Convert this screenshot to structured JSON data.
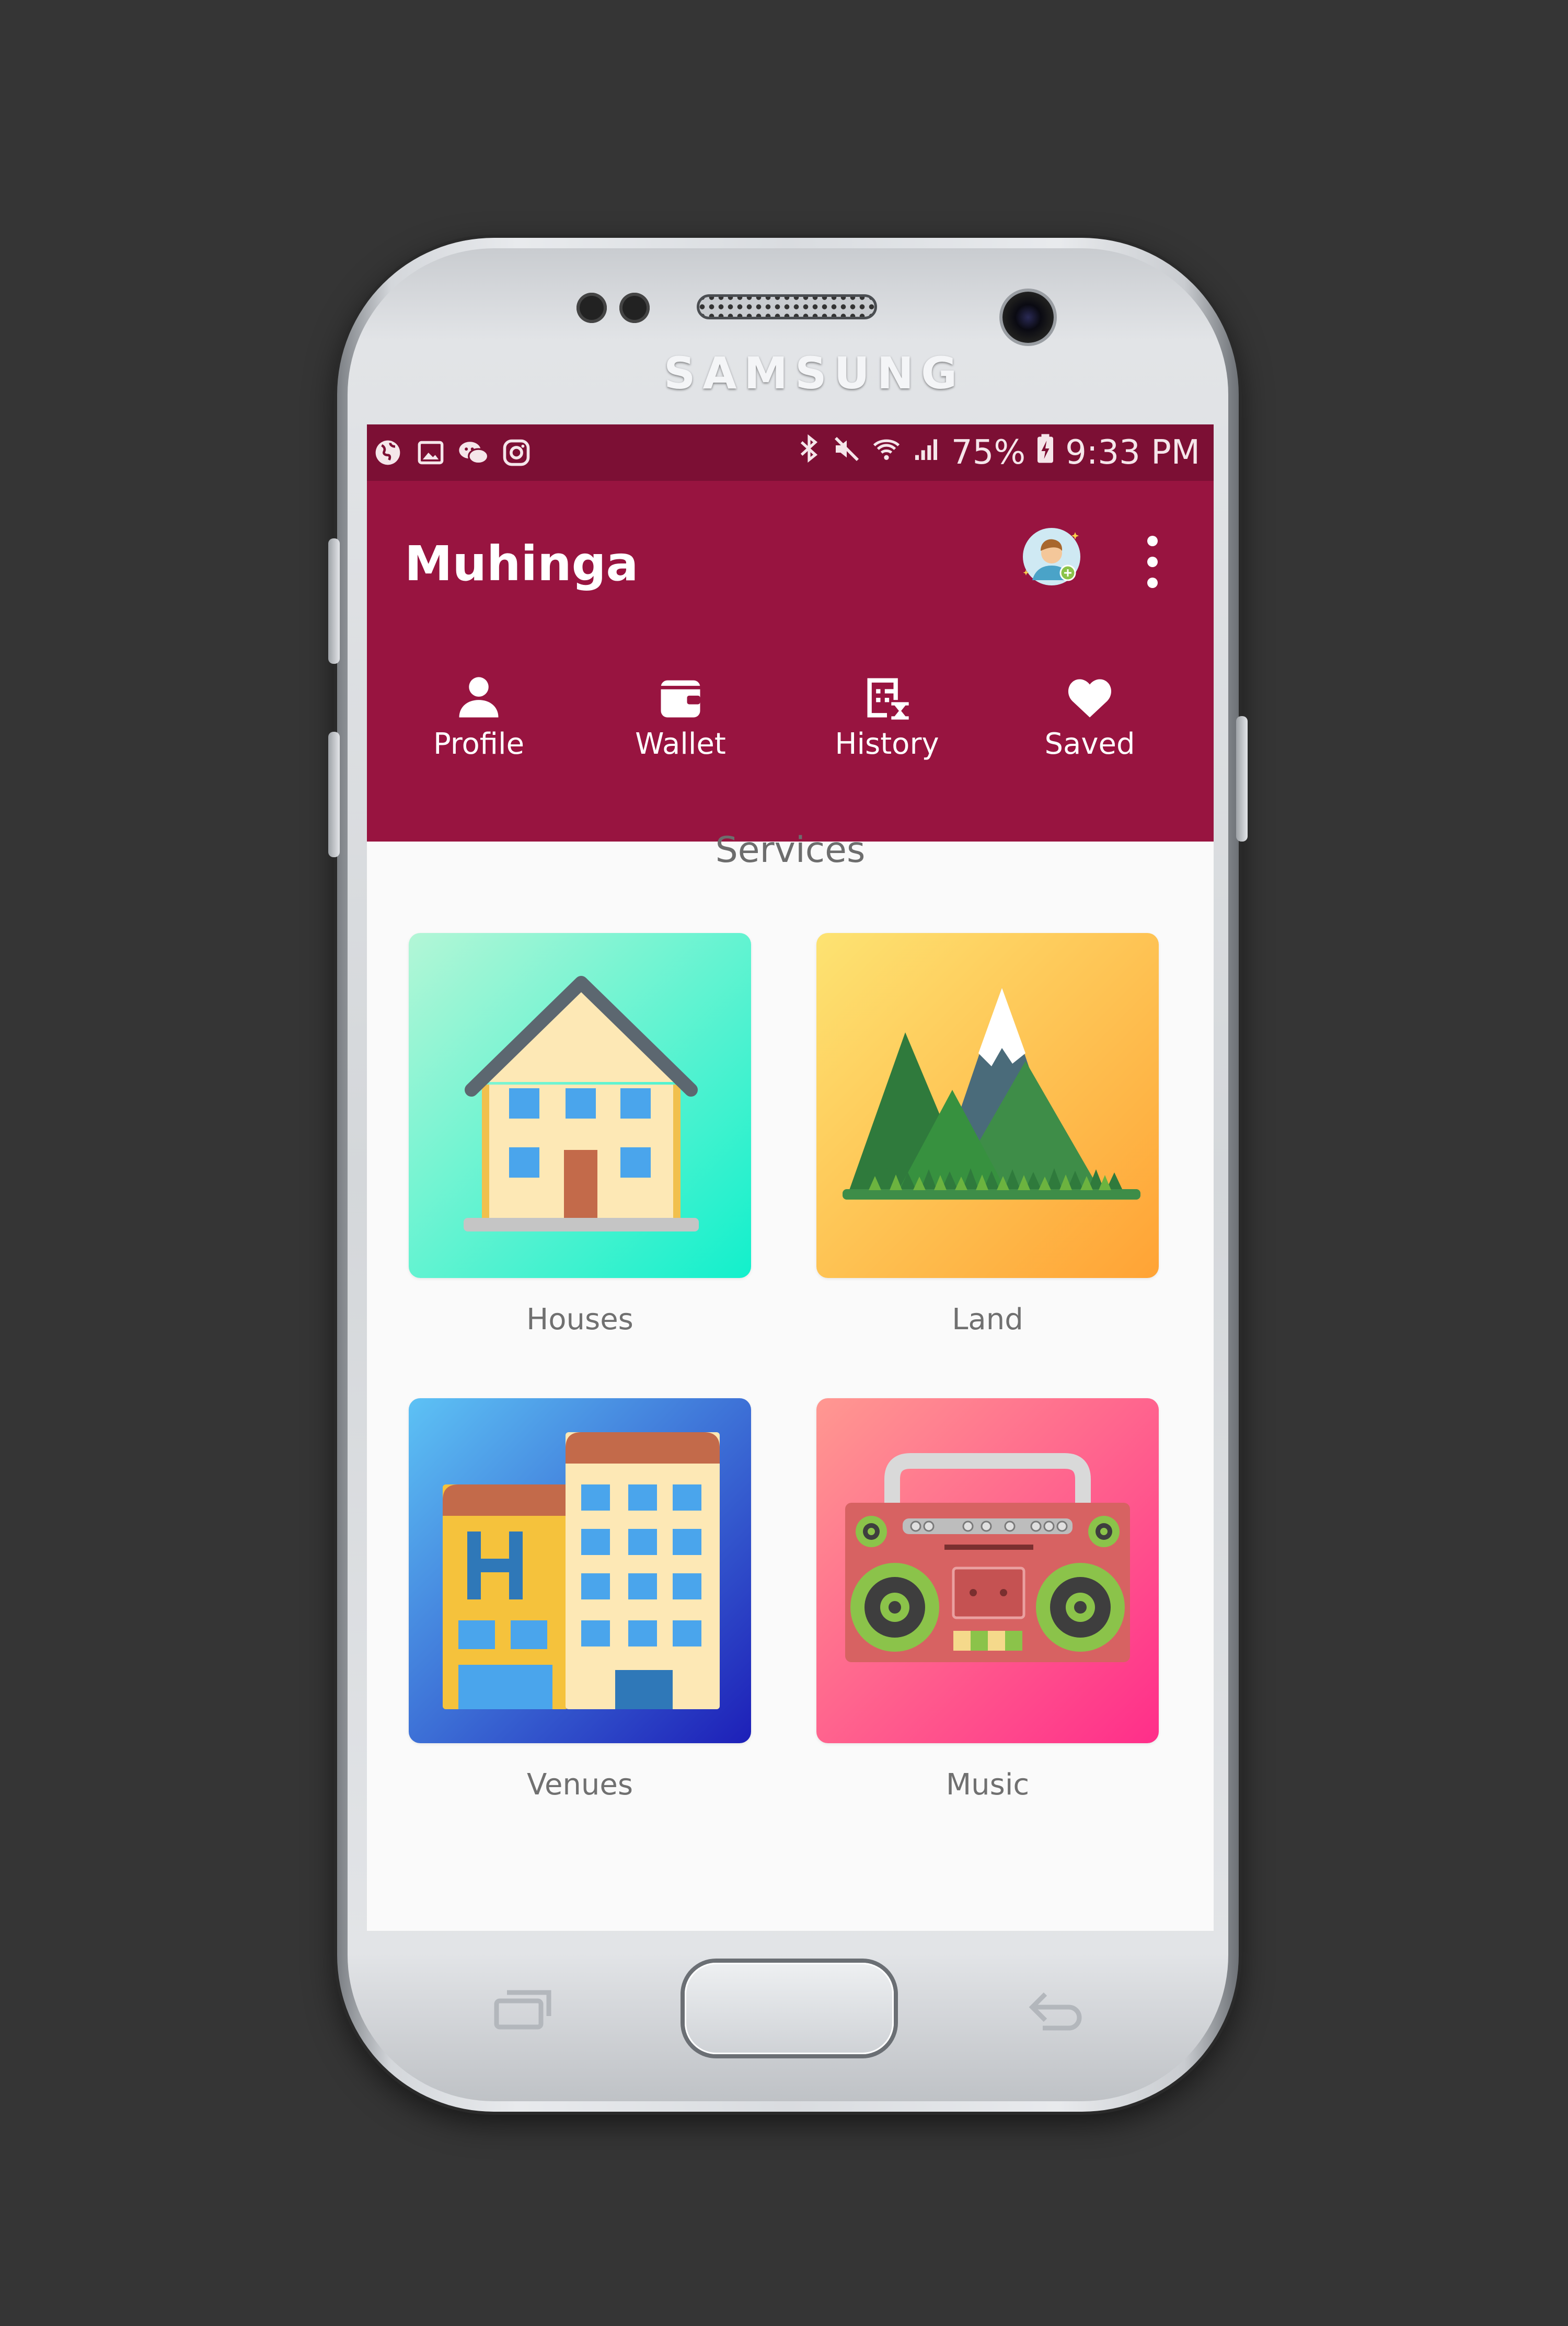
{
  "device": {
    "brand": "SAMSUNG"
  },
  "status_bar": {
    "battery": "75%",
    "time": "9:33 PM",
    "left_icons": [
      "globe-icon",
      "image-icon",
      "wechat-icon",
      "instagram-icon"
    ],
    "right_icons": [
      "bluetooth-icon",
      "mute-icon",
      "wifi-icon",
      "signal-icon",
      "battery-charging-icon"
    ]
  },
  "app_bar": {
    "title": "Muhinga",
    "color": "#981440",
    "status_color": "#7c0f34"
  },
  "nav": {
    "items": [
      {
        "label": "Profile",
        "icon": "person-icon"
      },
      {
        "label": "Wallet",
        "icon": "wallet-icon"
      },
      {
        "label": "History",
        "icon": "history-icon"
      },
      {
        "label": "Saved",
        "icon": "heart-icon"
      }
    ]
  },
  "services": {
    "title": "Services",
    "items": [
      {
        "label": "Houses",
        "icon": "house-illustration"
      },
      {
        "label": "Land",
        "icon": "mountain-illustration"
      },
      {
        "label": "Venues",
        "icon": "hotel-illustration"
      },
      {
        "label": "Music",
        "icon": "boombox-illustration"
      }
    ]
  }
}
